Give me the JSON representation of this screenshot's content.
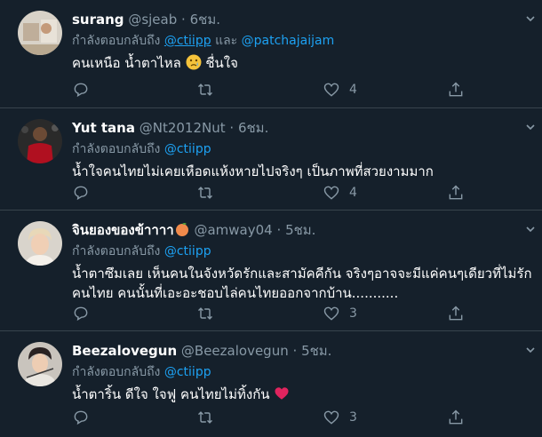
{
  "tweets": [
    {
      "name": "surang",
      "handle": "@sjeab",
      "time": "6ชม.",
      "reply_prefix": "กำลังตอบกลับถึง",
      "mention1": "@ctiipp",
      "conj": "และ",
      "mention2": "@patchajaijam",
      "text": "คนเหนือ น้ำตาไหล",
      "text_after_emoji": "ชื่นใจ",
      "emoji": "crying-face",
      "likes": "4"
    },
    {
      "name": "Yut tana",
      "handle": "@Nt2012Nut",
      "time": "6ชม.",
      "reply_prefix": "กำลังตอบกลับถึง",
      "mention1": "@ctiipp",
      "text": "น้ำใจคนไทยไม่เคยเหือดแห้งหายไปจริงๆ  เป็นภาพที่สวยงามมาก",
      "likes": "4"
    },
    {
      "name": "จินยองของข้าาาา",
      "handle": "@amway04",
      "time": "5ชม.",
      "name_emoji": "peach",
      "reply_prefix": "กำลังตอบกลับถึง",
      "mention1": "@ctiipp",
      "text": "น้ำตาซึมเลย เห็นคนในจังหวัดรักและสามัคคีกัน จริงๆอาจจะมีแค่คนๆเดียวที่ไม่รักคนไทย คนนั้นที่เอะอะชอบไล่คนไทยออกจากบ้าน...........",
      "likes": "3"
    },
    {
      "name": "Beezalovegun",
      "handle": "@Beezalovegun",
      "time": "5ชม.",
      "reply_prefix": "กำลังตอบกลับถึง",
      "mention1": "@ctiipp",
      "text": "น้ำตาริ้น ดีใจ ใจฟู คนไทยไม่ทิ้งกัน",
      "emoji": "red-heart",
      "likes": "3"
    }
  ],
  "colors": {
    "bg": "#15202b",
    "muted": "#8899a6",
    "link": "#1da1f2",
    "divider": "#38444d"
  },
  "icons": [
    "chevron-down-icon",
    "reply-icon",
    "retweet-icon",
    "like-icon",
    "share-icon"
  ]
}
